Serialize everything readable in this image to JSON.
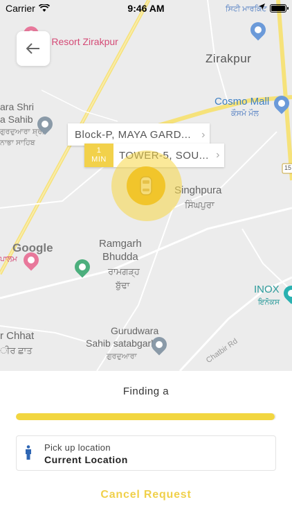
{
  "status_bar": {
    "carrier": "Carrier",
    "time": "9:46 AM"
  },
  "map": {
    "labels": {
      "resort": "ople Resort Zirakpur",
      "city_market": "ਸਿਟੀ ਮਾਰਕਿਟ",
      "zirakpur": "Zirakpur",
      "gurudwara_left_1": "ara Shri",
      "gurudwara_left_2": "a Sahib",
      "gurudwara_left_pa1": "ਗੁਰਦੁਆਰਾ ਸ਼੍ਰੀ",
      "gurudwara_left_pa2": "ਨਾਭਾ ਸਾਹਿਬ",
      "cosmo_mall": "Cosmo Mall",
      "cosmo_mall_pa": "ਕੌਸਮੋ ਮੌਲ",
      "singhpura": "Singhpura",
      "singhpura_pa": "ਸਿੰਘਪੁਰਾ",
      "road_15": "15",
      "google": "Google",
      "palam_pa": "ਪਾਲਮ",
      "ramgarh_1": "Ramgarh",
      "ramgarh_2": "Bhudda",
      "ramgarh_pa1": "ਰਾਮਗੜ੍ਹ",
      "ramgarh_pa2": "ਬੁੱਢਾ",
      "inox": "INOX",
      "inox_pa": "ਇਨੋਕਸ",
      "chhat": "r Chhat",
      "chhat_pa": "ੀਰ ਛਾਤ",
      "gurudwara_sb_1": "Gurudwara",
      "gurudwara_sb_2": "Sahib satabgarh",
      "gurudwara_sb_pa": "ਗੁਰਦੁਆਰਾ",
      "chatbir_rd": "Chatbir Rd"
    },
    "callouts": {
      "pickup_place": "Block-P, MAYA GARD...",
      "driver_place": "TOWER-5, SOU...",
      "eta_value": "1",
      "eta_unit": "MIN"
    }
  },
  "sheet": {
    "finding_text": "Finding a",
    "progress": 0.995,
    "pickup_label": "Pick up location",
    "pickup_value": "Current Location",
    "cancel_label": "Cancel Request"
  },
  "colors": {
    "accent": "#f2d640",
    "map_bg": "#ececec"
  },
  "icons": [
    "back-arrow-icon",
    "wifi-icon",
    "location-arrow-icon",
    "battery-icon",
    "person-icon",
    "car-icon",
    "chevron-right-icon"
  ]
}
